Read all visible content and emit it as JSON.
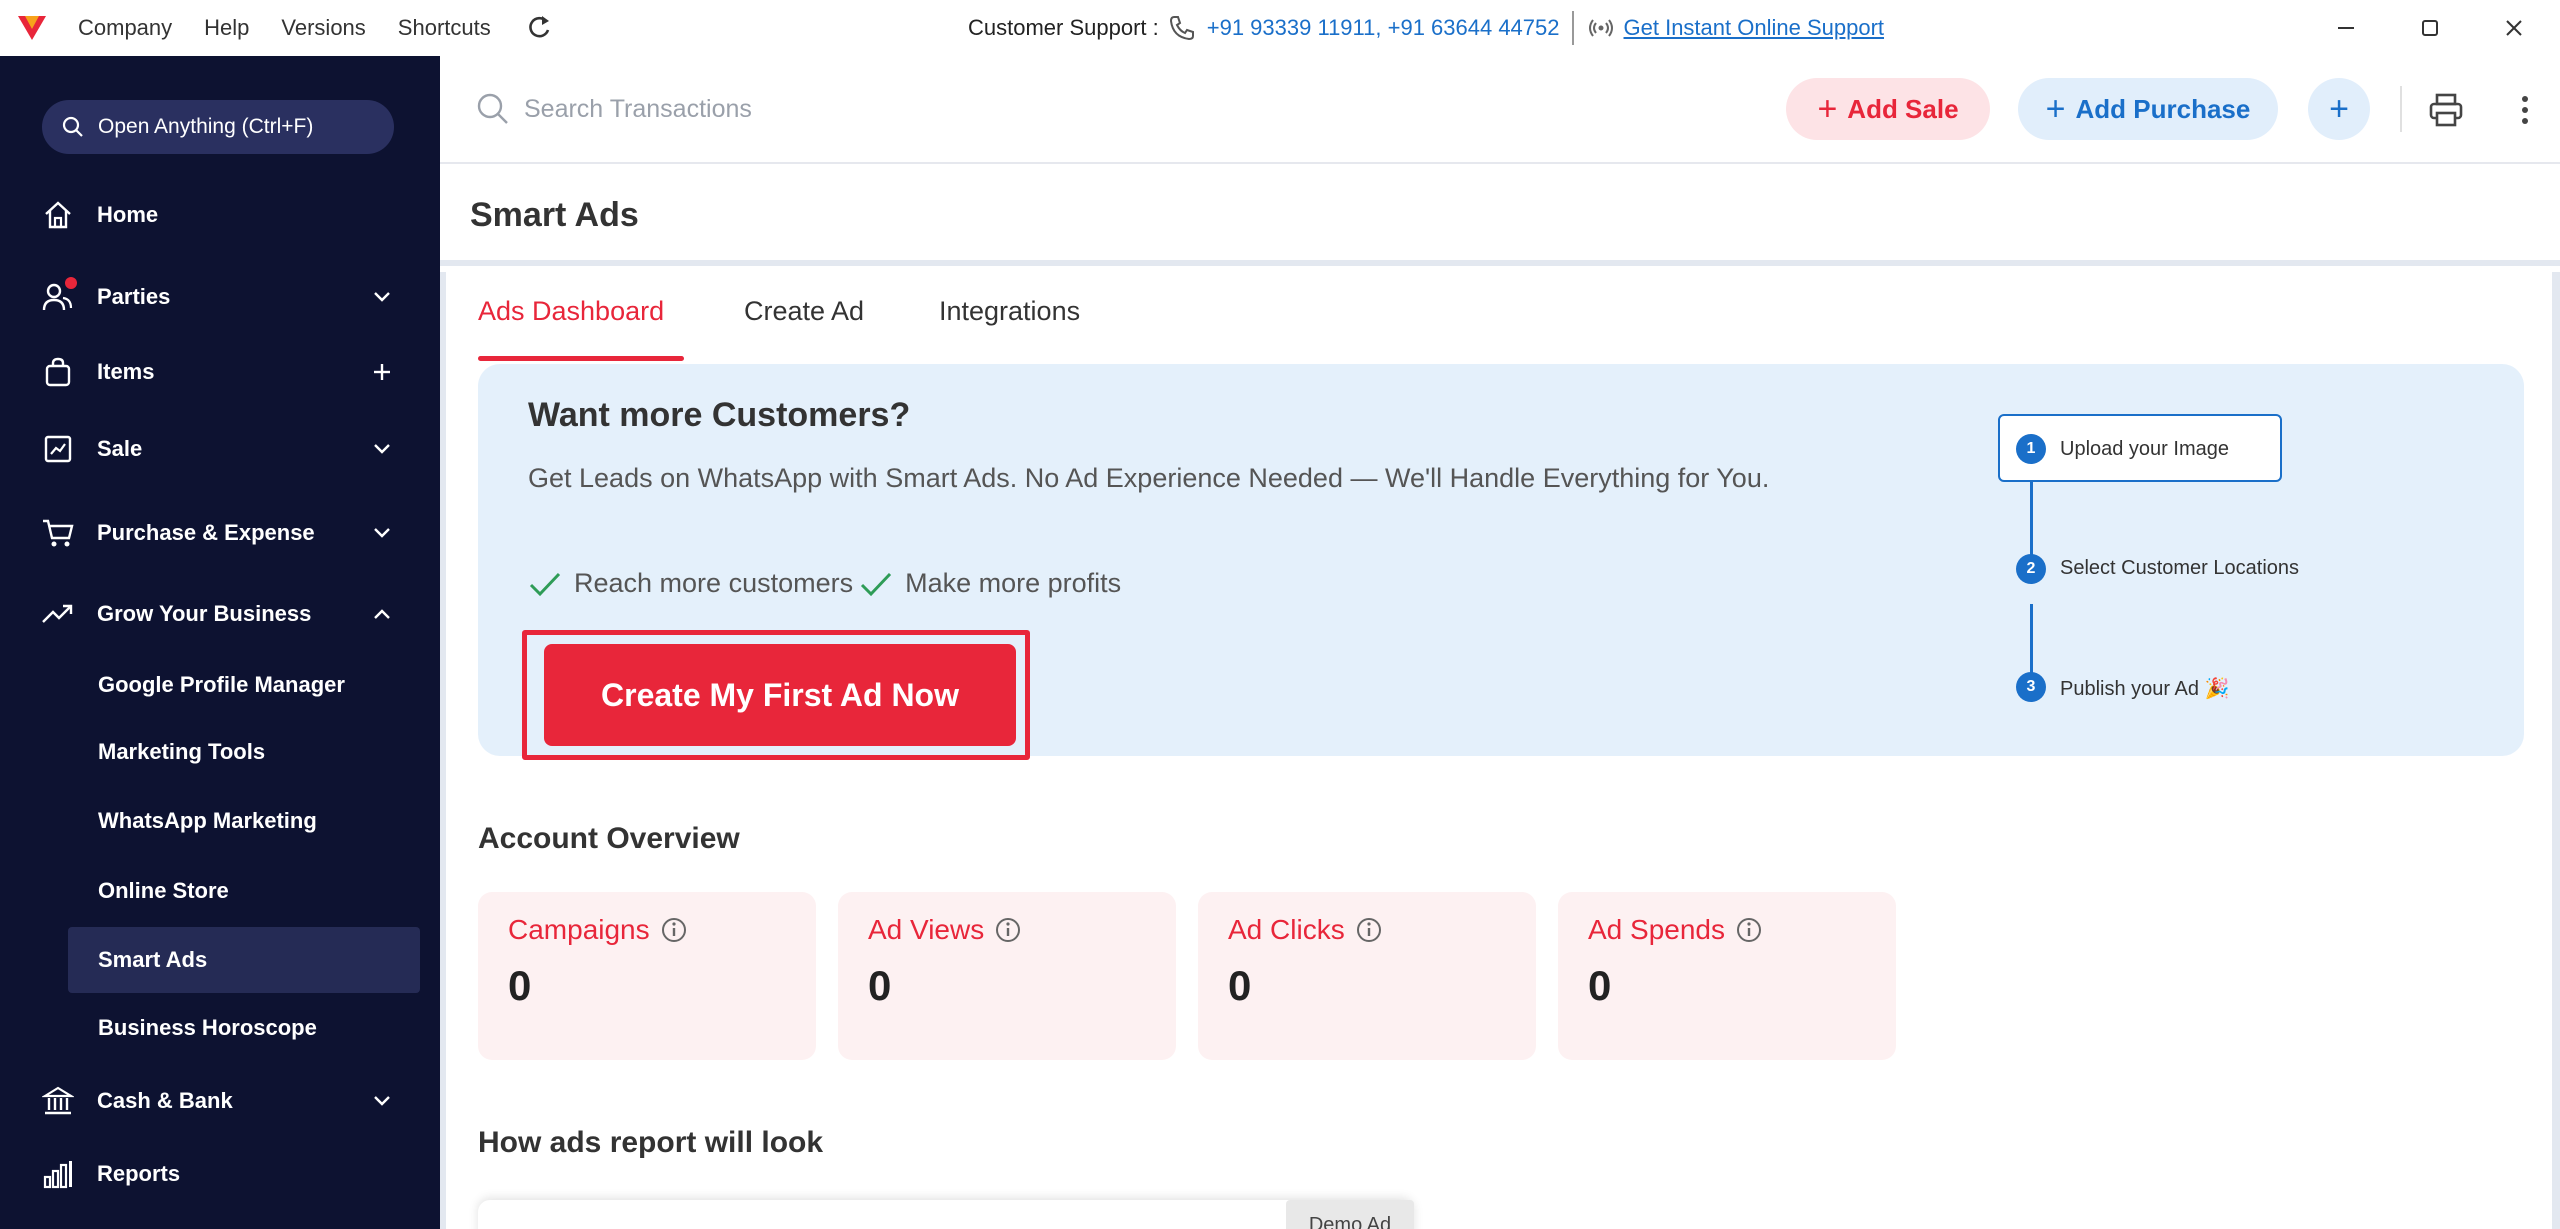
{
  "titlebar": {
    "menu": [
      "Company",
      "Help",
      "Versions",
      "Shortcuts"
    ],
    "support_label": "Customer Support :",
    "support_phones": "+91 93339 11911, +91 63644 44752",
    "online_support": "Get Instant Online Support"
  },
  "sidebar": {
    "search_label": "Open Anything (Ctrl+F)",
    "items": [
      {
        "label": "Home",
        "icon": "home-icon"
      },
      {
        "label": "Parties",
        "icon": "parties-icon",
        "trail": "chevron-down"
      },
      {
        "label": "Items",
        "icon": "items-icon",
        "trail": "plus"
      },
      {
        "label": "Sale",
        "icon": "sale-icon",
        "trail": "chevron-down"
      },
      {
        "label": "Purchase & Expense",
        "icon": "cart-icon",
        "trail": "chevron-down"
      },
      {
        "label": "Grow Your Business",
        "icon": "trend-icon",
        "trail": "chevron-up"
      },
      {
        "label": "Cash & Bank",
        "icon": "bank-icon",
        "trail": "chevron-down"
      },
      {
        "label": "Reports",
        "icon": "reports-icon"
      }
    ],
    "sub_items": [
      {
        "label": "Google Profile Manager"
      },
      {
        "label": "Marketing Tools"
      },
      {
        "label": "WhatsApp Marketing"
      },
      {
        "label": "Online Store"
      },
      {
        "label": "Smart Ads",
        "active": true
      },
      {
        "label": "Business Horoscope"
      }
    ]
  },
  "toolbar": {
    "search_placeholder": "Search Transactions",
    "add_sale": "Add Sale",
    "add_purchase": "Add Purchase"
  },
  "page": {
    "title": "Smart Ads",
    "tabs": [
      "Ads Dashboard",
      "Create Ad",
      "Integrations"
    ],
    "active_tab": "Ads Dashboard"
  },
  "banner": {
    "title": "Want more Customers?",
    "desc": "Get Leads on WhatsApp with Smart Ads. No Ad Experience Needed — We'll Handle Everything for You.",
    "check1": "Reach more customers",
    "check2": "Make more profits",
    "cta": "Create My First Ad Now",
    "steps": [
      {
        "num": "1",
        "label": "Upload your Image"
      },
      {
        "num": "2",
        "label": "Select Customer Locations"
      },
      {
        "num": "3",
        "label": "Publish your Ad 🎉"
      }
    ]
  },
  "overview": {
    "title": "Account Overview",
    "cards": [
      {
        "label": "Campaigns",
        "value": "0"
      },
      {
        "label": "Ad Views",
        "value": "0"
      },
      {
        "label": "Ad Clicks",
        "value": "0"
      },
      {
        "label": "Ad Spends",
        "value": "0"
      }
    ]
  },
  "report": {
    "title": "How ads report will look",
    "demo_badge": "Demo Ad"
  },
  "colors": {
    "sidebar_bg": "#0d1231",
    "accent_red": "#e8263a",
    "accent_blue": "#1a6fc9",
    "banner_bg": "#e4f0fb"
  }
}
